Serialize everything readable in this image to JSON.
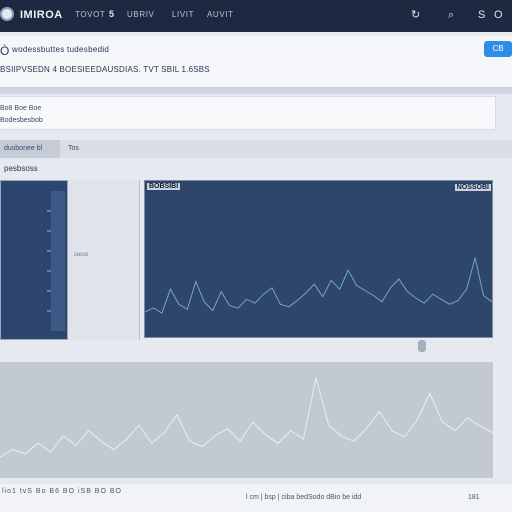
{
  "topbar": {
    "brand": "IMIROA",
    "nav": [
      "TOVOT",
      "5",
      "UBRIV",
      "LIVIT",
      "AUVIT"
    ],
    "icons": [
      "refresh-icon",
      "search-icon",
      "user-icon",
      "settings-icon"
    ],
    "icon_glyphs": [
      "↻",
      "⌕",
      "S",
      "O"
    ]
  },
  "header": {
    "mode_glyph": "Ò",
    "title": "wodessbuttes tudesbedid",
    "subtitle": "BSIIPVSEDN 4 BOESIEEDAUSDIAS. TVT SBIL 1.6SBS",
    "action_label": "CB"
  },
  "filter": {
    "line1": "Bo8 Boe Boe",
    "line2": "Bodesbesbob"
  },
  "tabs": [
    "dusbonee bl",
    "Tos"
  ],
  "section_label": "pesbsoss",
  "panels": {
    "mid_label": "iaeso",
    "main_title": "BOBSIBI",
    "main_tag": "NOSSOBI"
  },
  "status": {
    "left": "lio1 tvS Bo B6 BO iSB BO BO",
    "middle": "l cm | bsp | ciba bedSodo dBio be idd",
    "right": "181"
  },
  "colors": {
    "topbar": "#1c2940",
    "chart_bg": "#2e4669",
    "series_line": "#6fa6cf",
    "accent": "#2d8de8"
  },
  "chart_data": [
    {
      "type": "line",
      "title": "BOBSIBI",
      "series": [
        {
          "name": "NOSSOBI",
          "values": [
            0.12,
            0.15,
            0.11,
            0.3,
            0.18,
            0.14,
            0.36,
            0.2,
            0.13,
            0.28,
            0.17,
            0.15,
            0.22,
            0.19,
            0.26,
            0.31,
            0.18,
            0.16,
            0.21,
            0.27,
            0.34,
            0.24,
            0.37,
            0.3,
            0.45,
            0.33,
            0.29,
            0.25,
            0.2,
            0.31,
            0.38,
            0.28,
            0.23,
            0.19,
            0.26,
            0.22,
            0.18,
            0.21,
            0.3,
            0.55,
            0.25,
            0.2
          ]
        }
      ],
      "grid": false,
      "legend": "top-right"
    },
    {
      "type": "line",
      "series": [
        {
          "name": "",
          "values": [
            0.15,
            0.22,
            0.18,
            0.28,
            0.2,
            0.35,
            0.26,
            0.4,
            0.3,
            0.22,
            0.32,
            0.45,
            0.28,
            0.38,
            0.55,
            0.3,
            0.25,
            0.35,
            0.42,
            0.3,
            0.48,
            0.36,
            0.28,
            0.4,
            0.32,
            0.9,
            0.45,
            0.35,
            0.3,
            0.42,
            0.58,
            0.4,
            0.34,
            0.5,
            0.75,
            0.48,
            0.4,
            0.52,
            0.44,
            0.38
          ]
        }
      ],
      "grid": false
    }
  ]
}
